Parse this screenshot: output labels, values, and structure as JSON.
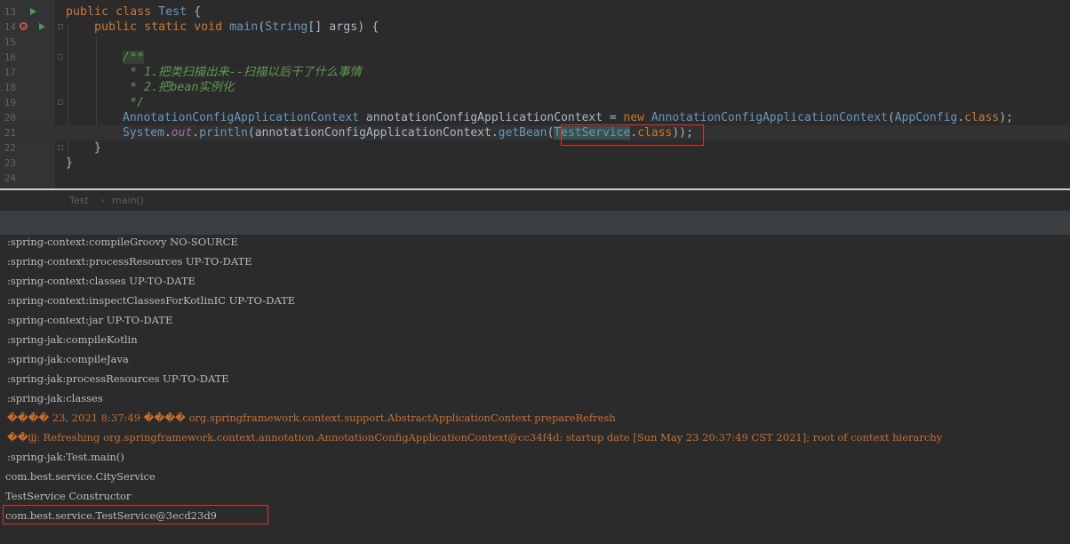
{
  "editor": {
    "lines": [
      {
        "num": "13"
      },
      {
        "num": "14"
      },
      {
        "num": "15"
      },
      {
        "num": "16"
      },
      {
        "num": "17"
      },
      {
        "num": "18"
      },
      {
        "num": "19"
      },
      {
        "num": "20"
      },
      {
        "num": "21"
      },
      {
        "num": "22"
      },
      {
        "num": "23"
      },
      {
        "num": "24"
      }
    ],
    "l13": {
      "kw1": "public",
      "kw2": "class",
      "name": "Test",
      "brace": "{"
    },
    "l14": {
      "kw1": "public",
      "kw2": "static",
      "kw3": "void",
      "fn": "main",
      "p1": "(",
      "type": "String",
      "rest": "[] args) {"
    },
    "l16": {
      "doc": "/**"
    },
    "l17": {
      "doc": " * 1.把类扫描出来--扫描以后干了什么事情"
    },
    "l18": {
      "doc": " * 2.把bean实例化"
    },
    "l19": {
      "doc": " */"
    },
    "l20": {
      "type1": "AnnotationConfigApplicationContext",
      "var": " annotationConfigApplicationContext = ",
      "kw": "new",
      "type2": " AnnotationConfigApplicationContext",
      "p1": "(",
      "type3": "AppConfig",
      "dot": ".",
      "kw2": "class",
      "end": ");"
    },
    "l21": {
      "type1": "System",
      "dot1": ".",
      "field": "out",
      "dot2": ".",
      "fn": "println",
      "arg": "(annotationConfigApplicationContext.",
      "fn2": "getBean",
      "p": "(",
      "cls": "TestService",
      "dot3": ".",
      "kw": "class",
      "end": "));"
    },
    "l22": {
      "brace": "}"
    },
    "l23": {
      "brace": "}"
    }
  },
  "breadcrumb": {
    "item1": "Test",
    "sep": "›",
    "item2": "main()"
  },
  "console": {
    "lines": [
      {
        "text": ":spring-context:compileGroovy NO-SOURCE"
      },
      {
        "text": ":spring-context:processResources UP-TO-DATE"
      },
      {
        "text": ":spring-context:classes UP-TO-DATE"
      },
      {
        "text": ":spring-context:inspectClassesForKotlinIC UP-TO-DATE"
      },
      {
        "text": ":spring-context:jar UP-TO-DATE"
      },
      {
        "text": ":spring-jak:compileKotlin"
      },
      {
        "text": ":spring-jak:compileJava"
      },
      {
        "text": ":spring-jak:processResources UP-TO-DATE"
      },
      {
        "text": ":spring-jak:classes"
      },
      {
        "text": "���� 23, 2021 8:37:49 ���� org.springframework.context.support.AbstractApplicationContext prepareRefresh"
      },
      {
        "text": "��Ϣ: Refreshing org.springframework.context.annotation.AnnotationConfigApplicationContext@cc34f4d: startup date [Sun May 23 20:37:49 CST 2021]; root of context hierarchy"
      },
      {
        "text": ":spring-jak:Test.main()"
      },
      {
        "text": "com.best.service.CityService"
      },
      {
        "text": "TestService Constructor"
      },
      {
        "text": "com.best.service.TestService@3ecd23d9"
      }
    ]
  }
}
